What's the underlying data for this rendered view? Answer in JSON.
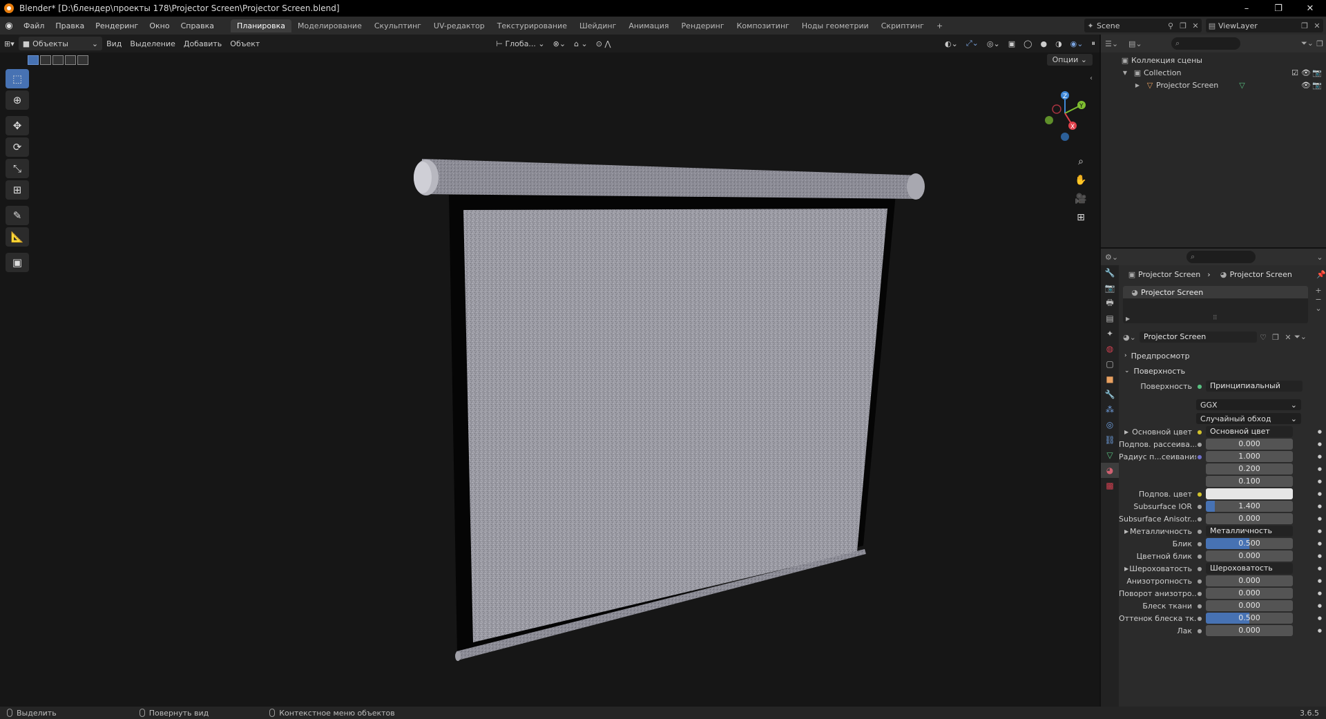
{
  "window": {
    "title": "Blender* [D:\\блендер\\проекты 178\\Projector Screen\\Projector Screen.blend]",
    "minimize": "–",
    "maximize": "❐",
    "close": "✕"
  },
  "menu": [
    "Файл",
    "Правка",
    "Рендеринг",
    "Окно",
    "Справка"
  ],
  "workspaces": [
    "Планировка",
    "Моделирование",
    "Скульптинг",
    "UV-редактор",
    "Текстурирование",
    "Шейдинг",
    "Анимация",
    "Рендеринг",
    "Композитинг",
    "Ноды геометрии",
    "Скриптинг",
    "+"
  ],
  "scene": {
    "label": "Scene",
    "viewlayer": "ViewLayer"
  },
  "viewport": {
    "mode": "Объекты",
    "menus": [
      "Вид",
      "Выделение",
      "Добавить",
      "Объект"
    ],
    "transform": "Глоба...",
    "options": "Опции"
  },
  "outliner": {
    "scene_collection": "Коллекция сцены",
    "collection": "Collection",
    "object": "Projector Screen"
  },
  "properties": {
    "breadcrumb_object": "Projector Screen",
    "breadcrumb_material": "Projector Screen",
    "slot": "Projector Screen",
    "material_name": "Projector Screen",
    "panel_preview": "Предпросмотр",
    "panel_surface": "Поверхность",
    "surface_label": "Поверхность",
    "surface_value": "Принципиальный BSDF",
    "distribution": "GGX",
    "subsurface_method": "Случайный обход",
    "rows": [
      {
        "label": "Основной цвет",
        "kind": "link",
        "value": "Основной цвет",
        "socket": "yellow",
        "expand": true
      },
      {
        "label": "Подпов. рассеива...",
        "kind": "num",
        "value": "0.000",
        "socket": "gray"
      },
      {
        "label": "Радиус п...сеивания",
        "kind": "num",
        "value": "1.000",
        "socket": "purple"
      },
      {
        "label": "",
        "kind": "num",
        "value": "0.200"
      },
      {
        "label": "",
        "kind": "num",
        "value": "0.100"
      },
      {
        "label": "Подпов. цвет",
        "kind": "color",
        "value": "",
        "socket": "yellow"
      },
      {
        "label": "Subsurface IOR",
        "kind": "slider",
        "value": "1.400",
        "fill": 0.1,
        "socket": "gray"
      },
      {
        "label": "Subsurface Anisotr...",
        "kind": "num",
        "value": "0.000",
        "socket": "gray"
      },
      {
        "label": "Металличность",
        "kind": "link",
        "value": "Металличность",
        "socket": "gray",
        "expand": true
      },
      {
        "label": "Блик",
        "kind": "slider",
        "value": "0.500",
        "fill": 0.5,
        "socket": "gray"
      },
      {
        "label": "Цветной блик",
        "kind": "num",
        "value": "0.000",
        "socket": "gray"
      },
      {
        "label": "Шероховатость",
        "kind": "link",
        "value": "Шероховатость",
        "socket": "gray",
        "expand": true
      },
      {
        "label": "Анизотропность",
        "kind": "num",
        "value": "0.000",
        "socket": "gray"
      },
      {
        "label": "Поворот анизотро...",
        "kind": "num",
        "value": "0.000",
        "socket": "gray"
      },
      {
        "label": "Блеск ткани",
        "kind": "num",
        "value": "0.000",
        "socket": "gray"
      },
      {
        "label": "Оттенок блеска тк...",
        "kind": "slider",
        "value": "0.500",
        "fill": 0.5,
        "socket": "gray"
      },
      {
        "label": "Лак",
        "kind": "num",
        "value": "0.000",
        "socket": "gray"
      }
    ]
  },
  "statusbar": {
    "select": "Выделить",
    "rotate": "Повернуть вид",
    "context": "Контекстное меню объектов",
    "version": "3.6.5"
  },
  "colors": {
    "accent": "#4772b3",
    "axis_x": "#e0404a",
    "axis_y": "#7fbf30",
    "axis_z": "#3f88d8"
  }
}
